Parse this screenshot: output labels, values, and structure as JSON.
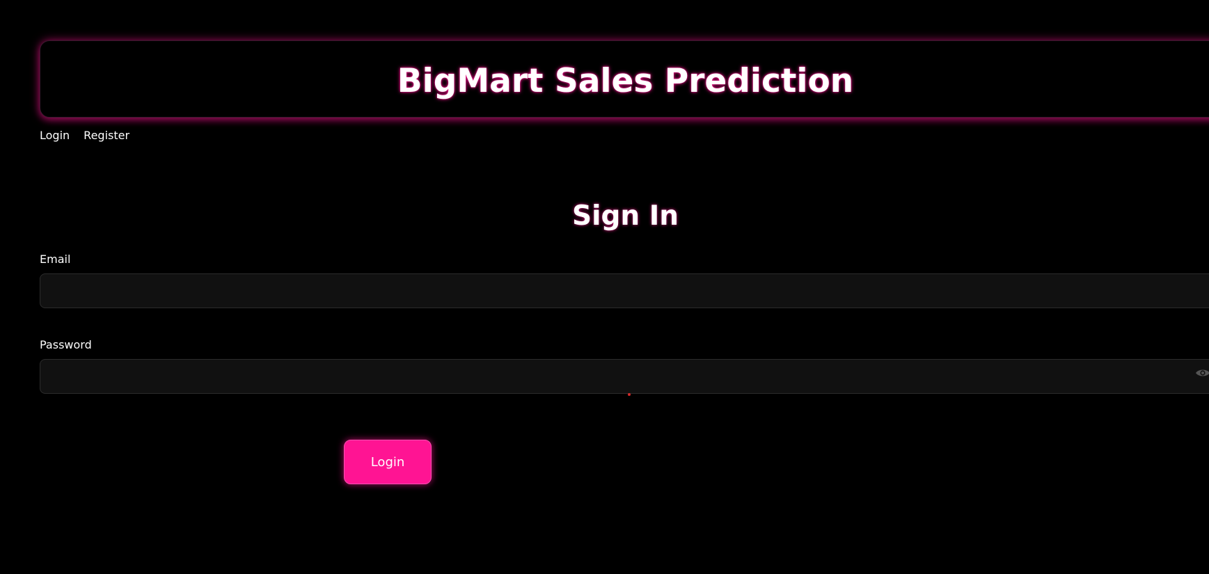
{
  "app": {
    "title": "BigMart Sales Prediction"
  },
  "nav": {
    "items": [
      {
        "label": "Login"
      },
      {
        "label": "Register"
      }
    ]
  },
  "form": {
    "heading": "Sign In",
    "email": {
      "label": "Email",
      "value": "",
      "placeholder": ""
    },
    "password": {
      "label": "Password",
      "value": "",
      "placeholder": "",
      "toggle_icon": "eye-icon"
    },
    "submit_label": "Login"
  },
  "colors": {
    "background": "#000000",
    "accent": "#ff1493",
    "text": "#ffffff",
    "input_background": "#111111"
  }
}
